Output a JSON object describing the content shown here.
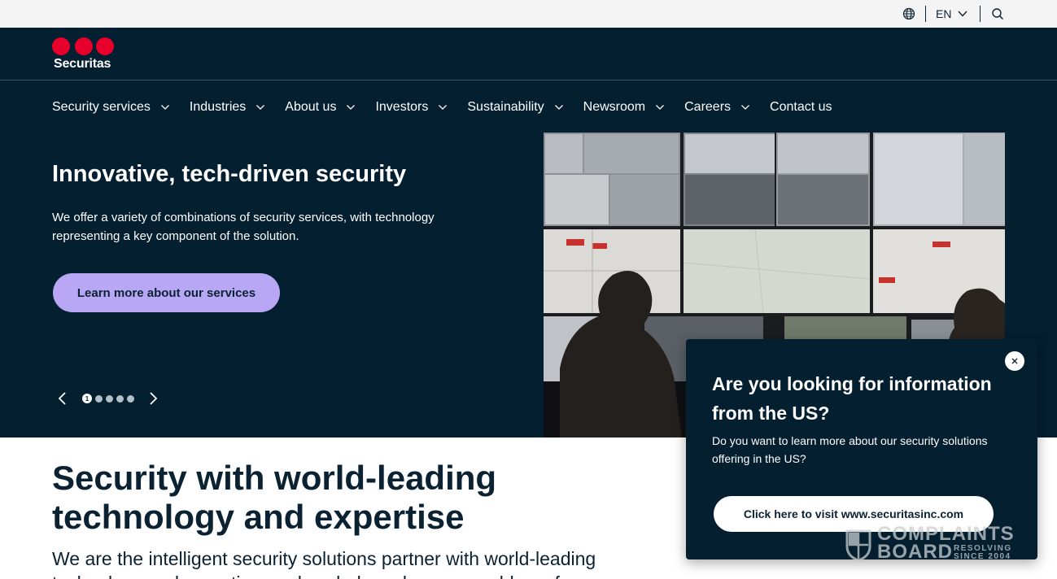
{
  "utility_bar": {
    "language": "EN",
    "icons": [
      "globe-icon",
      "chevron-down-icon",
      "search-icon"
    ]
  },
  "brand": {
    "name": "Securitas",
    "color": "#e6002b"
  },
  "nav": {
    "items": [
      {
        "label": "Security services",
        "has_dropdown": true
      },
      {
        "label": "Industries",
        "has_dropdown": true
      },
      {
        "label": "About us",
        "has_dropdown": true
      },
      {
        "label": "Investors",
        "has_dropdown": true
      },
      {
        "label": "Sustainability",
        "has_dropdown": true
      },
      {
        "label": "Newsroom",
        "has_dropdown": true
      },
      {
        "label": "Careers",
        "has_dropdown": true
      },
      {
        "label": "Contact us",
        "has_dropdown": false
      }
    ]
  },
  "hero": {
    "title": "Innovative, tech-driven security",
    "description": "We offer a variety of combinations of security services, with technology representing a key component of the solution.",
    "cta_label": "Learn more about our services",
    "carousel": {
      "current": "1",
      "total": 5
    }
  },
  "main": {
    "title": "Security with world-leading technology and expertise",
    "description": "We are the intelligent security solutions partner with world-leading technology and expertise, and we help make your world a safer"
  },
  "popup": {
    "title": "Are you looking for information from the US?",
    "description": "Do you want to learn more about our security solutions offering in the US?",
    "button_label": "Click here to visit www.securitasinc.com"
  },
  "watermark": {
    "main": "COMPLAINTS",
    "line2": "BOARD",
    "sub1": "RESOLVING",
    "sub2": "SINCE 2004"
  },
  "colors": {
    "navy": "#031f30",
    "accent_purple": "#b7a7f4",
    "brand_red": "#e6002b"
  }
}
